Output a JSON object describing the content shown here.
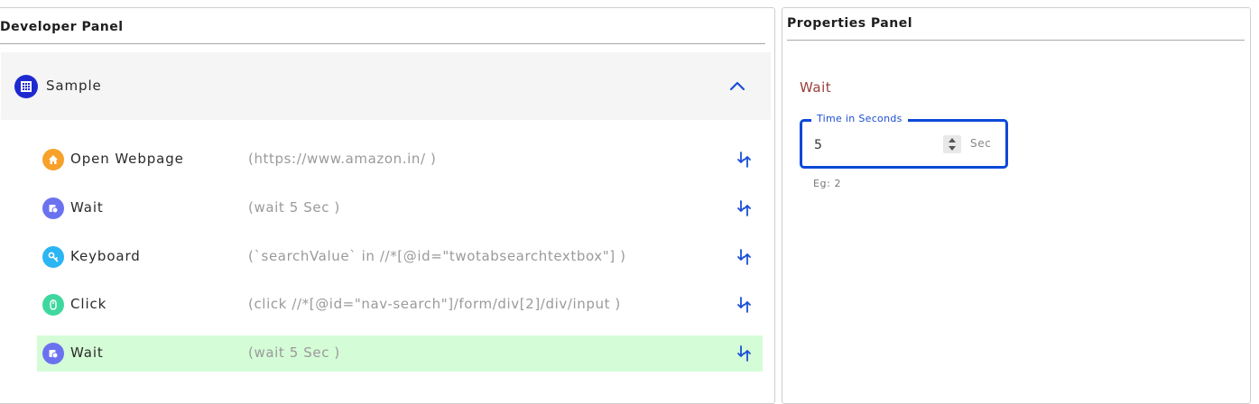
{
  "developer_panel": {
    "title": "Developer Panel",
    "group": {
      "label": "Sample",
      "icon": "calendar-grid-icon",
      "expanded": true
    },
    "steps": [
      {
        "name": "Open Webpage",
        "params": "(https://www.amazon.in/ )",
        "icon": "home-icon",
        "icon_color": "#f7a12b",
        "selected": false
      },
      {
        "name": "Wait",
        "params": "(wait 5 Sec )",
        "icon": "timer-icon",
        "icon_color": "#6b72f0",
        "selected": false
      },
      {
        "name": "Keyboard",
        "params": "(`searchValue` in //*[@id=\"twotabsearchtextbox\"] )",
        "icon": "key-icon",
        "icon_color": "#2bb5f2",
        "selected": false
      },
      {
        "name": "Click",
        "params": "(click //*[@id=\"nav-search\"]/form/div[2]/div/input )",
        "icon": "mouse-icon",
        "icon_color": "#3fd7a0",
        "selected": false
      },
      {
        "name": "Wait",
        "params": "(wait 5 Sec )",
        "icon": "timer-icon",
        "icon_color": "#6b72f0",
        "selected": true
      }
    ]
  },
  "properties_panel": {
    "title": "Properties Panel",
    "section_title": "Wait",
    "field": {
      "legend": "Time in Seconds",
      "value": "5",
      "unit": "Sec",
      "hint": "Eg: 2"
    }
  },
  "colors": {
    "accent": "#0b49d6",
    "selected_row": "#d4fcd6",
    "section_title": "#9b3d3d",
    "group_icon": "#1e2ad0"
  }
}
